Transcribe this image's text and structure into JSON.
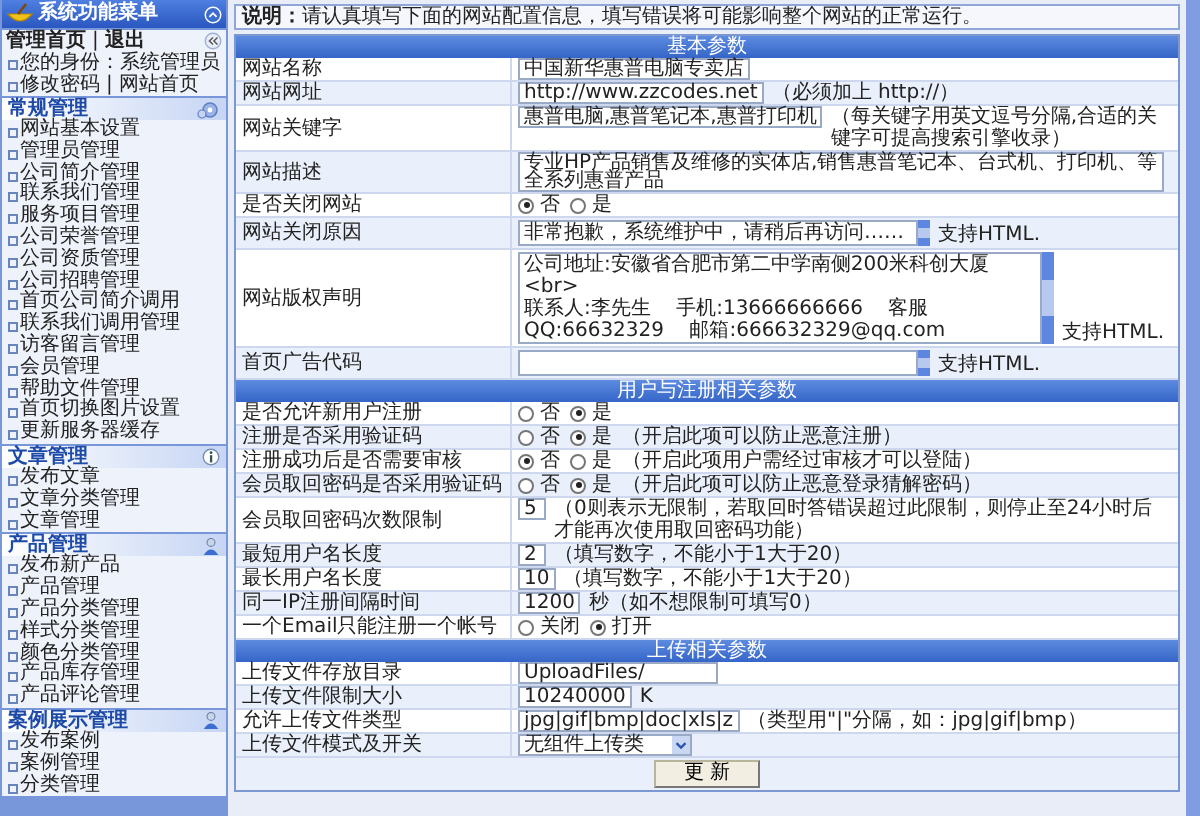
{
  "sidebar": {
    "title": "系统功能菜单",
    "top_links": [
      "管理首页",
      "退出"
    ],
    "separator": "|",
    "identity": "您的身份：系统管理员",
    "links": [
      "修改密码",
      "网站首页"
    ],
    "groups": [
      {
        "title": "常规管理",
        "items": [
          "网站基本设置",
          "管理员管理",
          "公司简介管理",
          "联系我们管理",
          "服务项目管理",
          "公司荣誉管理",
          "公司资质管理",
          "公司招聘管理",
          "首页公司简介调用",
          "联系我们调用管理",
          "访客留言管理",
          "会员管理",
          "帮助文件管理",
          "首页切换图片设置",
          "更新服务器缓存"
        ]
      },
      {
        "title": "文章管理",
        "items": [
          "发布文章",
          "文章分类管理",
          "文章管理"
        ]
      },
      {
        "title": "产品管理",
        "items": [
          "发布新产品",
          "产品管理",
          "产品分类管理",
          "样式分类管理",
          "颜色分类管理",
          "产品库存管理",
          "产品评论管理"
        ]
      },
      {
        "title": "案例展示管理",
        "items": [
          "发布案例",
          "案例管理",
          "分类管理"
        ]
      }
    ]
  },
  "note": {
    "title": "说明：",
    "text": "请认真填写下面的网站配置信息，填写错误将可能影响整个网站的正常运行。"
  },
  "sections": [
    {
      "title": "基本参数",
      "rows": [
        {
          "label": "网站名称",
          "kind": "input",
          "value": "中国新华惠普电脑专卖店"
        },
        {
          "label": "网站网址",
          "kind": "input",
          "value": "http://www.zzcodes.net",
          "hint": "（必须加上 http://）"
        },
        {
          "label": "网站关键字",
          "kind": "input",
          "value": "惠普电脑,惠普笔记本,惠普打印机",
          "hint": "（每关键字用英文逗号分隔,合适的关键字可提高搜索引擎收录）"
        },
        {
          "label": "网站描述",
          "kind": "input",
          "value": "专业HP产品销售及维修的实体店,销售惠普笔记本、台式机、打印机、等全系列惠普产品"
        },
        {
          "label": "是否关闭网站",
          "kind": "radio",
          "options": [
            {
              "label": "否",
              "selected": true
            },
            {
              "label": "是",
              "selected": false
            }
          ]
        },
        {
          "label": "网站关闭原因",
          "kind": "textarea",
          "value": "非常抱歉，系统维护中，请稍后再访问……",
          "hint": "支持HTML."
        },
        {
          "label": "网站版权声明",
          "kind": "textarea",
          "value": "公司地址:安徽省合肥市第二中学南侧200米科创大厦<br>\n联系人:李先生    手机:13666666666    客服QQ:66632329    邮箱:666632329@qq.com",
          "hint": "支持HTML."
        },
        {
          "label": "首页广告代码",
          "kind": "textarea",
          "hint": "支持HTML."
        }
      ]
    },
    {
      "title": "用户与注册相关参数",
      "rows": [
        {
          "label": "是否允许新用户注册",
          "kind": "radio",
          "options": [
            {
              "label": "否",
              "selected": false
            },
            {
              "label": "是",
              "selected": true
            }
          ]
        },
        {
          "label": "注册是否采用验证码",
          "kind": "radio",
          "options": [
            {
              "label": "否",
              "selected": false
            },
            {
              "label": "是",
              "selected": true
            }
          ],
          "hint": "（开启此项可以防止恶意注册）"
        },
        {
          "label": "注册成功后是否需要审核",
          "kind": "radio",
          "options": [
            {
              "label": "否",
              "selected": true
            },
            {
              "label": "是",
              "selected": false
            }
          ],
          "hint": "（开启此项用户需经过审核才可以登陆）"
        },
        {
          "label": "会员取回密码是否采用验证码",
          "kind": "radio",
          "options": [
            {
              "label": "否",
              "selected": false
            },
            {
              "label": "是",
              "selected": true
            }
          ],
          "hint": "（开启此项可以防止恶意登录猜解密码）"
        },
        {
          "label": "会员取回密码次数限制",
          "kind": "number",
          "value": "5",
          "hint": "（0则表示无限制，若取回时答错误超过此限制，则停止至24小时后才能再次使用取回密码功能）"
        },
        {
          "label": "最短用户名长度",
          "kind": "number",
          "value": "2",
          "hint": "（填写数字，不能小于1大于20）"
        },
        {
          "label": "最长用户名长度",
          "kind": "number",
          "value": "10",
          "hint": "（填写数字，不能小于1大于20）"
        },
        {
          "label": "同一IP注册间隔时间",
          "kind": "number",
          "value": "1200",
          "hint": "秒（如不想限制可填写0）"
        },
        {
          "label": "一个Email只能注册一个帐号",
          "kind": "radio",
          "options": [
            {
              "label": "关闭",
              "selected": false
            },
            {
              "label": "打开",
              "selected": true
            }
          ]
        }
      ]
    },
    {
      "title": "上传相关参数",
      "rows": [
        {
          "label": "上传文件存放目录",
          "kind": "input",
          "value": "UploadFiles/"
        },
        {
          "label": "上传文件限制大小",
          "kind": "number",
          "value": "10240000",
          "hint": "K"
        },
        {
          "label": "允许上传文件类型",
          "kind": "input",
          "value": "jpg|gif|bmp|doc|xls|z",
          "hint": "（类型用\"|\"分隔，如：jpg|gif|bmp）"
        },
        {
          "label": "上传文件模式及开关",
          "kind": "select",
          "value": "无组件上传类"
        }
      ]
    }
  ],
  "submit": "更 新"
}
